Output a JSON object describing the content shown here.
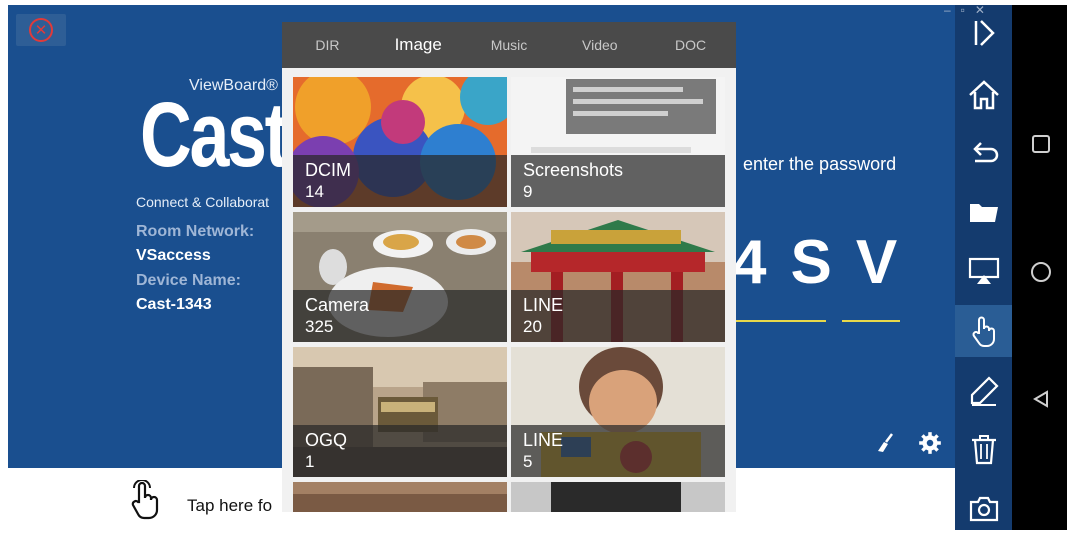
{
  "app": {
    "brand_small": "ViewBoard®",
    "brand_big": "Cast",
    "tagline": "Connect & Collaborat",
    "room_network_label": "Room Network:",
    "room_network_value": "VSaccess",
    "device_name_label": "Device Name:",
    "device_name_value": "Cast-1343",
    "password_hint": "enter the password",
    "code_chars": "4SV"
  },
  "bottom_bar": {
    "tap_text": "Tap here fo"
  },
  "picker": {
    "tabs": [
      {
        "label": "DIR",
        "active": false
      },
      {
        "label": "Image",
        "active": true
      },
      {
        "label": "Music",
        "active": false
      },
      {
        "label": "Video",
        "active": false
      },
      {
        "label": "DOC",
        "active": false
      }
    ],
    "folders": [
      {
        "name": "DCIM",
        "count": "14"
      },
      {
        "name": "Screenshots",
        "count": "9"
      },
      {
        "name": "Camera",
        "count": "325"
      },
      {
        "name": "LINE",
        "count": "20"
      },
      {
        "name": "OGQ",
        "count": "1"
      },
      {
        "name": "LINE",
        "count": "5"
      }
    ]
  },
  "toolbar": {
    "items": [
      "collapse-icon",
      "home-icon",
      "back-icon",
      "folder-icon",
      "airplay-icon",
      "touch-icon",
      "pen-icon",
      "trash-icon",
      "camera-icon"
    ],
    "active": "touch-icon"
  },
  "android_nav": [
    "recents-icon",
    "home-circle-icon",
    "back-triangle-icon"
  ],
  "colors": {
    "app_bg": "#1a4f8f",
    "toolbar_bg": "#143b6e",
    "picker_tab_bg": "#4a4a4a",
    "code_underline": "#e8d84a",
    "close_red": "#e03a3a"
  }
}
